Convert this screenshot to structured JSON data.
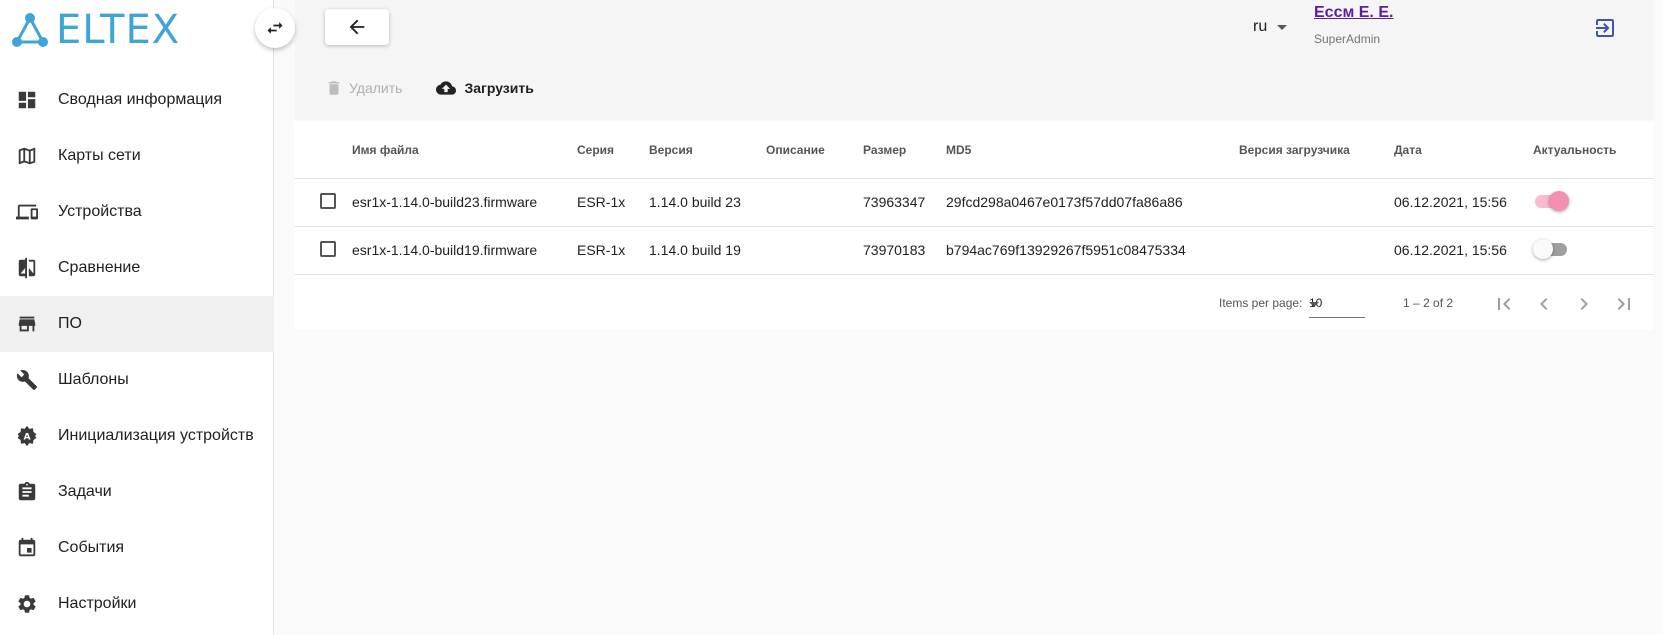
{
  "brand": {
    "logo_text": "ELTEX",
    "accent": "#3ea5d6"
  },
  "sidebar": {
    "items": [
      {
        "label": "Сводная информация",
        "icon": "dashboard-icon"
      },
      {
        "label": "Карты сети",
        "icon": "map-icon"
      },
      {
        "label": "Устройства",
        "icon": "devices-icon"
      },
      {
        "label": "Сравнение",
        "icon": "compare-icon"
      },
      {
        "label": "ПО",
        "icon": "store-icon",
        "active": true
      },
      {
        "label": "Шаблоны",
        "icon": "wrench-icon"
      },
      {
        "label": "Инициализация устройств",
        "icon": "auto-setup-icon"
      },
      {
        "label": "Задачи",
        "icon": "clipboard-icon"
      },
      {
        "label": "События",
        "icon": "calendar-icon"
      },
      {
        "label": "Настройки",
        "icon": "gear-icon"
      }
    ]
  },
  "header": {
    "lang": "ru",
    "user_name": "Ессм Е. Е.",
    "user_role": "SuperAdmin",
    "user_color": "#5a1ea0"
  },
  "toolbar": {
    "delete_label": "Удалить",
    "upload_label": "Загрузить"
  },
  "table": {
    "columns": [
      "Имя файла",
      "Серия",
      "Версия",
      "Описание",
      "Размер",
      "MD5",
      "Версия загрузчика",
      "Дата",
      "Актуальность"
    ],
    "rows": [
      {
        "file": "esr1x-1.14.0-build23.firmware",
        "series": "ESR-1x",
        "version": "1.14.0 build 23",
        "description": "",
        "size": "73963347",
        "md5": "29fcd298a0467e0173f57dd07fa86a86",
        "bootloader": "",
        "date": "06.12.2021, 15:56",
        "actual": true
      },
      {
        "file": "esr1x-1.14.0-build19.firmware",
        "series": "ESR-1x",
        "version": "1.14.0 build 19",
        "description": "",
        "size": "73970183",
        "md5": "b794ac769f13929267f5951c08475334",
        "bootloader": "",
        "date": "06.12.2021, 15:56",
        "actual": false
      }
    ]
  },
  "paginator": {
    "items_per_page_label": "Items per page:",
    "page_size": "10",
    "range": "1 – 2 of 2"
  }
}
